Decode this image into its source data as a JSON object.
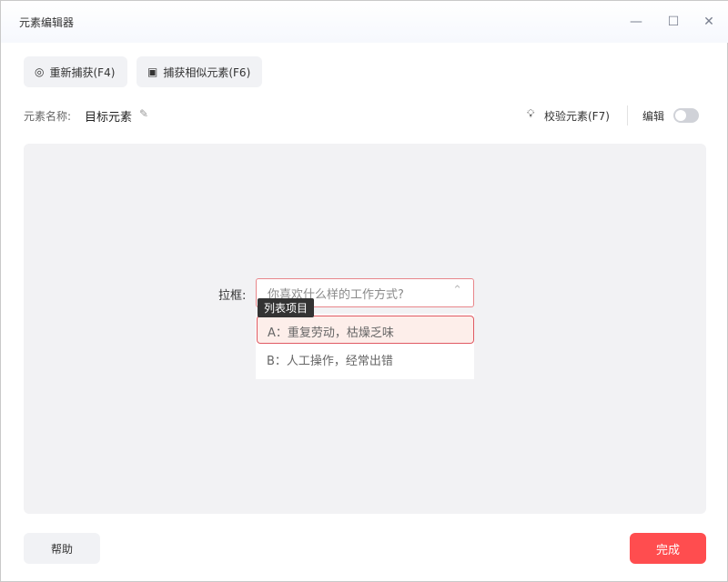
{
  "window": {
    "title": "元素编辑器",
    "minimize_icon": "minimize-icon",
    "maximize_icon": "maximize-icon",
    "close_icon": "close-icon"
  },
  "toolbar": {
    "recapture_label": "重新捕获(F4)",
    "capture_similar_label": "捕获相似元素(F6)"
  },
  "element": {
    "name_label": "元素名称:",
    "name_value": "目标元素",
    "validate_label": "校验元素(F7)",
    "edit_label": "编辑",
    "edit_enabled": false
  },
  "preview": {
    "field_label": "拉框:",
    "placeholder": "你喜欢什么样的工作方式?",
    "tooltip": "列表项目",
    "options": [
      "A：重复劳动，枯燥乏味",
      "B：人工操作，经常出错"
    ]
  },
  "footer": {
    "help_label": "帮助",
    "done_label": "完成"
  },
  "colors": {
    "accent": "#ff4d4f",
    "highlight": "#e05a63"
  }
}
